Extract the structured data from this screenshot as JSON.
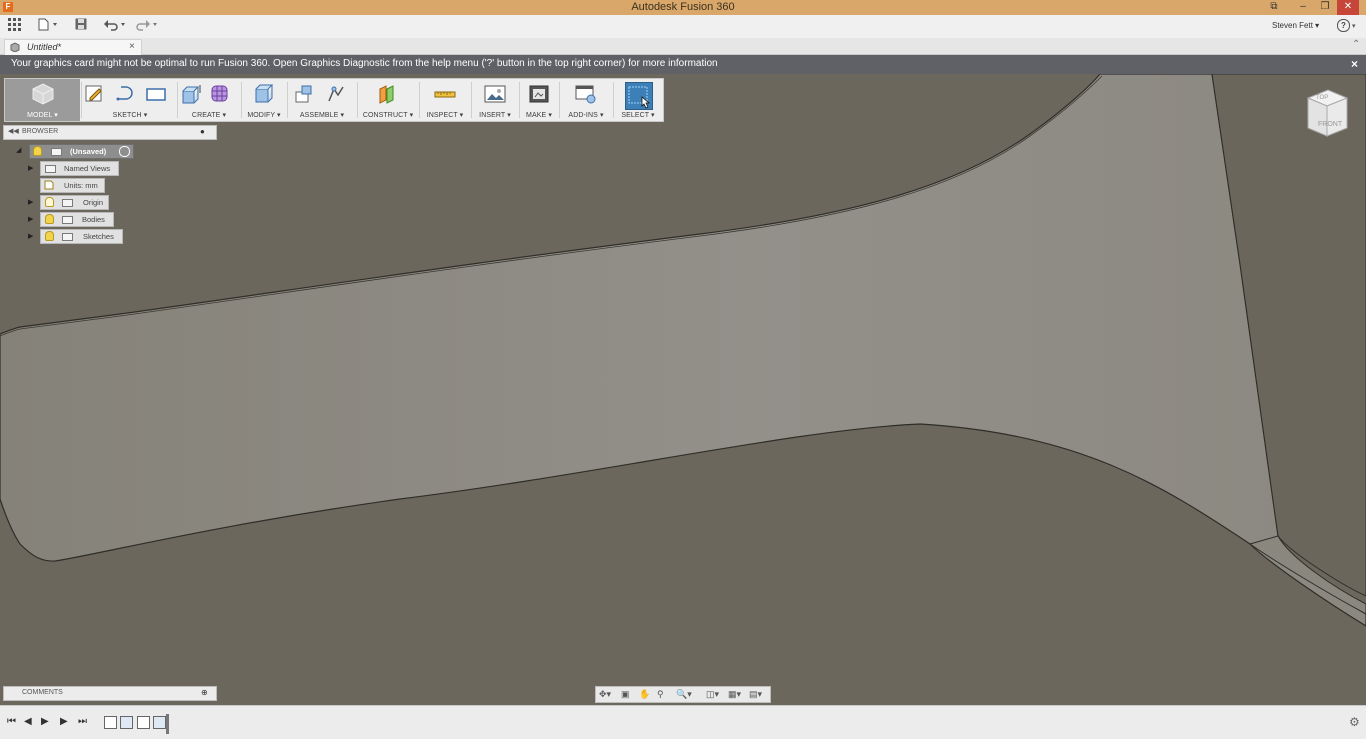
{
  "window": {
    "title": "Autodesk Fusion 360",
    "app_badge": "F",
    "controls": [
      "–",
      "❐",
      "✕"
    ],
    "restore_icon": "⧉"
  },
  "qat": {
    "user": "Steven Fett ▾",
    "help": "?"
  },
  "document_tab": {
    "label": "Untitled*",
    "close": "×"
  },
  "warning": {
    "message": "Your graphics card might not be optimal to run Fusion 360. Open Graphics Diagnostic from the help menu ('?' button in the top right corner) for more information",
    "close": "×"
  },
  "ribbon": {
    "workspace": "MODEL ▾",
    "groups": [
      {
        "label": "SKETCH ▾"
      },
      {
        "label": "CREATE ▾"
      },
      {
        "label": "MODIFY ▾"
      },
      {
        "label": "ASSEMBLE ▾"
      },
      {
        "label": "CONSTRUCT ▾"
      },
      {
        "label": "INSPECT ▾"
      },
      {
        "label": "INSERT ▾"
      },
      {
        "label": "MAKE ▾"
      },
      {
        "label": "ADD-INS ▾"
      },
      {
        "label": "SELECT ▾"
      }
    ]
  },
  "browser": {
    "title": "BROWSER",
    "root": "(Unsaved)",
    "nodes": [
      {
        "label": "Named Views"
      },
      {
        "label": "Units: mm"
      },
      {
        "label": "Origin"
      },
      {
        "label": "Bodies"
      },
      {
        "label": "Sketches"
      }
    ]
  },
  "comments": {
    "title": "COMMENTS"
  },
  "viewcube": {
    "top": "TOP",
    "front": "FRONT"
  },
  "colors": {
    "titlebar": "#d8a769",
    "viewport_bg": "#6c675d",
    "body_face": "#8e8b82",
    "select_accent": "#3d7fb7"
  }
}
